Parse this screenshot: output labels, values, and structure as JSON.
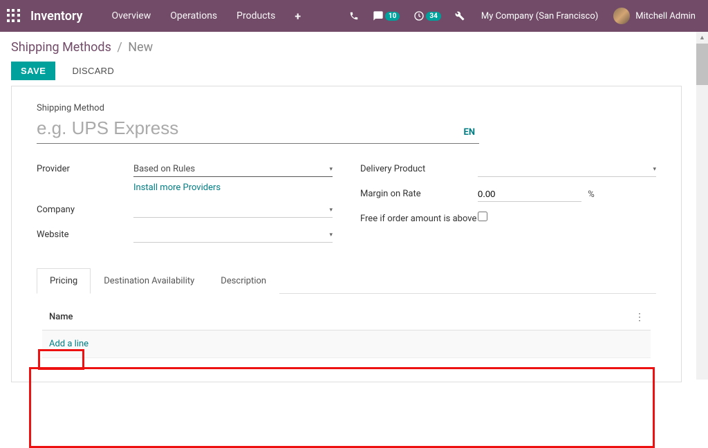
{
  "navbar": {
    "brand": "Inventory",
    "items": [
      "Overview",
      "Operations",
      "Products"
    ],
    "messages_badge": "10",
    "activities_badge": "34",
    "company": "My Company (San Francisco)",
    "user": "Mitchell Admin"
  },
  "breadcrumb": {
    "parent": "Shipping Methods",
    "current": "New"
  },
  "actions": {
    "save": "SAVE",
    "discard": "DISCARD"
  },
  "form": {
    "title_label": "Shipping Method",
    "title_placeholder": "e.g. UPS Express",
    "title_value": "",
    "lang": "EN",
    "left": {
      "provider_label": "Provider",
      "provider_value": "Based on Rules",
      "install_link": "Install more Providers",
      "company_label": "Company",
      "company_value": "",
      "website_label": "Website",
      "website_value": ""
    },
    "right": {
      "delivery_product_label": "Delivery Product",
      "delivery_product_value": "",
      "margin_label": "Margin on Rate",
      "margin_value": "0.00",
      "pct": "%",
      "free_label": "Free if order amount is above"
    },
    "tabs": [
      "Pricing",
      "Destination Availability",
      "Description"
    ],
    "table": {
      "header": "Name",
      "add_line": "Add a line"
    }
  }
}
